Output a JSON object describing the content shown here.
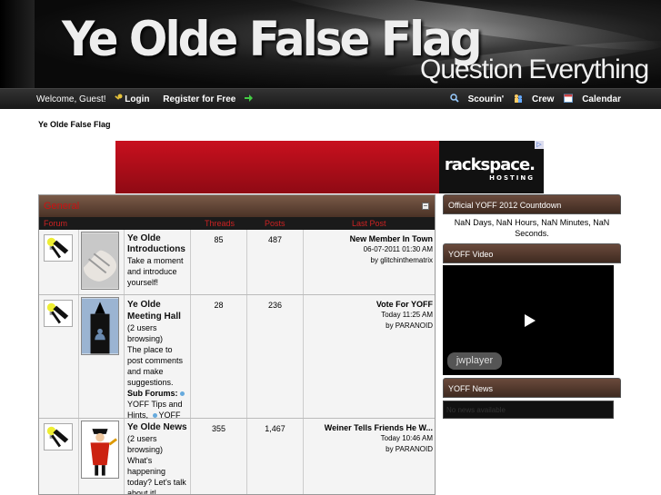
{
  "header": {
    "site_title": "Ye Olde False Flag",
    "tagline": "Question Everything"
  },
  "navbar": {
    "welcome": "Welcome, Guest!",
    "login": "Login",
    "register": "Register for Free",
    "search": "Scourin'",
    "crew": "Crew",
    "calendar": "Calendar"
  },
  "breadcrumb": "Ye Olde False Flag",
  "ad": {
    "brand": "rackspace.",
    "sub": "HOSTING"
  },
  "forum": {
    "category": "General",
    "columns": {
      "forum": "Forum",
      "threads": "Threads",
      "posts": "Posts",
      "last_post": "Last Post"
    },
    "rows": [
      {
        "title": "Ye Olde Introductions",
        "extra": "",
        "desc": "Take a moment and introduce yourself!",
        "sub_label": "",
        "subforums": [],
        "threads": "85",
        "posts": "487",
        "last_title": "New Member In Town",
        "last_time": "06-07-2011 01:30 AM",
        "last_by": "by glitchinthematrix"
      },
      {
        "title": "Ye Olde Meeting Hall",
        "extra": "(2 users browsing)",
        "desc": "The place to post comments and make suggestions.",
        "sub_label": "Sub Forums:",
        "subforums": [
          "YOFF Tips and Hints,",
          "YOFF Support"
        ],
        "threads": "28",
        "posts": "236",
        "last_title": "Vote For YOFF",
        "last_time": "Today 11:25 AM",
        "last_by": "by PARANOID"
      },
      {
        "title": "Ye Olde News",
        "extra": "(2 users browsing)",
        "desc": "What's happening today? Let's talk about it!",
        "sub_label": "",
        "subforums": [],
        "threads": "355",
        "posts": "1,467",
        "last_title": "Weiner Tells Friends He W...",
        "last_time": "Today 10:46 AM",
        "last_by": "by PARANOID"
      }
    ]
  },
  "sidebar": {
    "countdown_title": "Official YOFF 2012 Countdown",
    "countdown_text": "NaN Days, NaN Hours, NaN Minutes, NaN Seconds.",
    "video_title": "YOFF Video",
    "video_brand": "jwplayer",
    "news_title": "YOFF News",
    "news_text": "No news available"
  }
}
